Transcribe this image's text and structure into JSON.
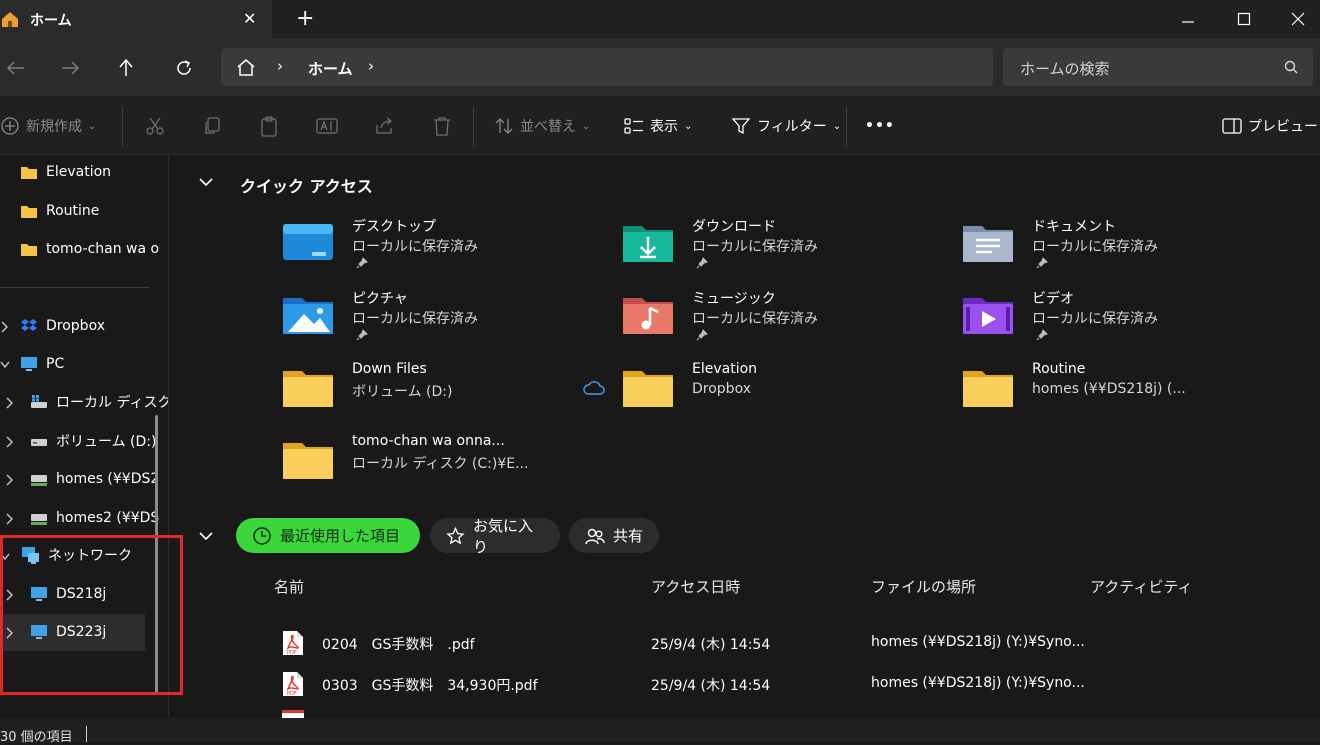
{
  "tab": {
    "title": "ホーム",
    "close": "✕",
    "new_tab": "+"
  },
  "window_controls": {
    "minimize": "—",
    "maximize": "☐",
    "close": "✕"
  },
  "address": {
    "crumb": "ホーム"
  },
  "search": {
    "placeholder": "ホームの検索"
  },
  "commands": {
    "new": "新規作成",
    "sort": "並べ替え",
    "view": "表示",
    "filter": "フィルター",
    "more": "•••",
    "preview": "プレビュー"
  },
  "nav": {
    "pinned": [
      "Elevation",
      "Routine",
      "tomo-chan wa o"
    ],
    "dropbox": "Dropbox",
    "pc": "PC",
    "drives": [
      "ローカル ディスク",
      "ボリューム (D:)",
      "homes (¥¥DS2",
      "homes2 (¥¥DS"
    ],
    "network": "ネットワーク",
    "nas": [
      "DS218j",
      "DS223j"
    ]
  },
  "quick_access": {
    "title": "クイック アクセス",
    "items": [
      {
        "name": "デスクトップ",
        "sub": "ローカルに保存済み",
        "icon": "desktop-icon"
      },
      {
        "name": "ダウンロード",
        "sub": "ローカルに保存済み",
        "icon": "download-icon"
      },
      {
        "name": "ドキュメント",
        "sub": "ローカルに保存済み",
        "icon": "documents-icon"
      },
      {
        "name": "ピクチャ",
        "sub": "ローカルに保存済み",
        "icon": "pictures-icon"
      },
      {
        "name": "ミュージック",
        "sub": "ローカルに保存済み",
        "icon": "music-icon"
      },
      {
        "name": "ビデオ",
        "sub": "ローカルに保存済み",
        "icon": "videos-icon"
      },
      {
        "name": "Down Files",
        "sub": "ボリューム (D:)",
        "icon": "folder-icon"
      },
      {
        "name": "Elevation",
        "sub": "Dropbox",
        "icon": "folder-icon"
      },
      {
        "name": "Routine",
        "sub": "homes (¥¥DS218j) (...",
        "icon": "folder-icon"
      },
      {
        "name": "tomo-chan wa onna...",
        "sub": "ローカル ディスク (C:)¥E...",
        "icon": "folder-icon"
      }
    ]
  },
  "recent_tabs": {
    "recent": "最近使用した項目",
    "favorites": "お気に入り",
    "shared": "共有"
  },
  "columns": {
    "name": "名前",
    "accessed": "アクセス日時",
    "location": "ファイルの場所",
    "activity": "アクティビティ"
  },
  "files": [
    {
      "name": "0204　GS手数料　.pdf",
      "accessed": "25/9/4 (木) 14:54",
      "location": "homes (¥¥DS218j) (Y:)¥Syno..."
    },
    {
      "name": "0303　GS手数料　34,930円.pdf",
      "accessed": "25/9/4 (木) 14:54",
      "location": "homes (¥¥DS218j) (Y:)¥Syno..."
    }
  ],
  "status": {
    "count": "30 個の項目"
  },
  "colors": {
    "accent_green": "#3bd63b",
    "highlight_red": "#e02a2a",
    "folder_yellow": "#f6c444",
    "pdf_red": "#d83a2f"
  }
}
